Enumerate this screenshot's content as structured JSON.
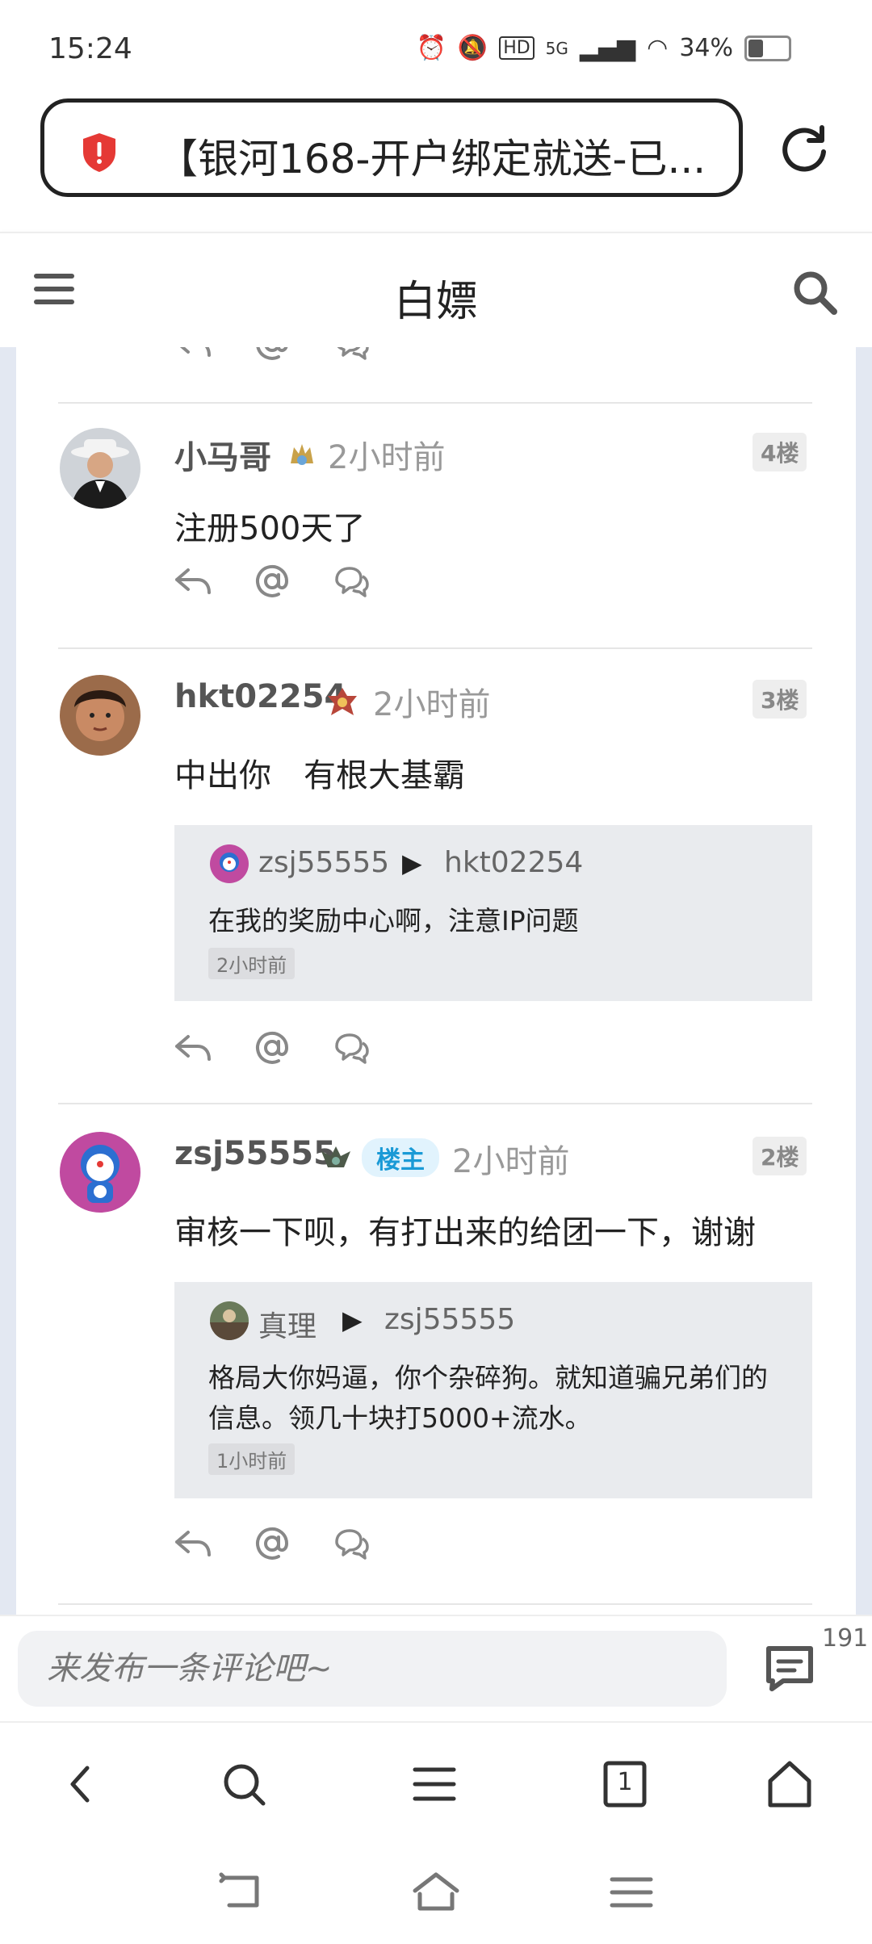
{
  "status_bar": {
    "time": "15:24",
    "network": "5G",
    "battery": "34%"
  },
  "address_bar": {
    "title": "【银河168-开户绑定就送-已..."
  },
  "top_nav": {
    "title": "白嫖"
  },
  "comments": [
    {
      "user": "小马哥",
      "owner_tag": "",
      "time": "2小时前",
      "floor": "4楼",
      "text": "注册500天了",
      "quote": null
    },
    {
      "user": "hkt02254",
      "owner_tag": "",
      "time": "2小时前",
      "floor": "3楼",
      "text": "中出你　有根大基霸",
      "quote": {
        "user": "zsj55555",
        "arrow": "▶",
        "target": "hkt02254",
        "text": "在我的奖励中心啊，注意IP问题",
        "time": "2小时前"
      }
    },
    {
      "user": "zsj55555",
      "owner_tag": "楼主",
      "time": "2小时前",
      "floor": "2楼",
      "text": "审核一下呗，有打出来的给团一下，谢谢",
      "quote": {
        "user": "真理",
        "arrow": "▶",
        "target": "zsj55555",
        "text": "格局大你妈逼，你个杂碎狗。就知道骗兄弟们的信息。领几十块打5000+流水。",
        "time": "1小时前"
      }
    }
  ],
  "composer": {
    "placeholder": "来发布一条评论吧~",
    "comment_count": "191"
  },
  "browser_bar": {
    "tab_count": "1"
  }
}
